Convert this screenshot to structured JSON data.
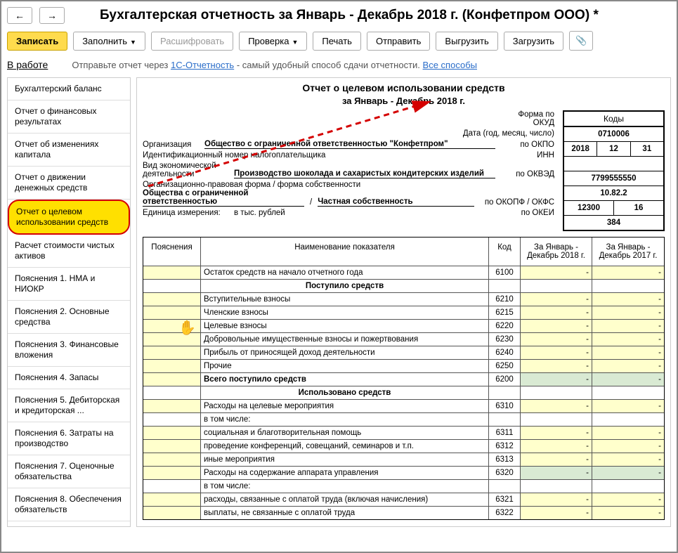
{
  "title": "Бухгалтерская отчетность за Январь - Декабрь 2018 г. (Конфетпром ООО) *",
  "nav": {
    "back": "←",
    "fwd": "→"
  },
  "toolbar": {
    "write": "Записать",
    "fill": "Заполнить",
    "decode": "Расшифровать",
    "check": "Проверка",
    "print": "Печать",
    "send": "Отправить",
    "export": "Выгрузить",
    "import": "Загрузить"
  },
  "status": {
    "label": "В работе",
    "text1": "Отправьте отчет через ",
    "link1": "1С-Отчетность",
    "text2": " - самый удобный способ сдачи отчетности. ",
    "link2": "Все способы"
  },
  "sidebar": [
    "Бухгалтерский баланс",
    "Отчет о финансовых результатах",
    "Отчет об изменениях капитала",
    "Отчет о движении денежных средств",
    "Отчет о целевом использовании средств",
    "Расчет стоимости чистых активов",
    "Пояснения 1. НМА и НИОКР",
    "Пояснения 2. Основные средства",
    "Пояснения 3. Финансовые вложения",
    "Пояснения 4. Запасы",
    "Пояснения 5. Дебиторская и кредиторская ...",
    "Пояснения 6. Затраты на производство",
    "Пояснения 7. Оценочные обязательства",
    "Пояснения 8. Обеспечения обязательств"
  ],
  "selectedIndex": 4,
  "report": {
    "title": "Отчет о целевом использовании средств",
    "period": "за Январь - Декабрь 2018 г.",
    "codes_header": "Коды",
    "rows": {
      "okud_l": "Форма по ОКУД",
      "okud_v": "0710006",
      "date_l": "Дата (год, месяц, число)",
      "date_y": "2018",
      "date_m": "12",
      "date_d": "31",
      "org_l": "Организация",
      "org_v": "Общество с ограниченной ответственностью \"Конфетпром\"",
      "okpo_l": "по ОКПО",
      "okpo_v": "",
      "inn_l": "Идентификационный номер налогоплательщика",
      "inn_r": "ИНН",
      "inn_v": "7799555550",
      "act_l": "Вид экономической деятельности",
      "act_v": "Производство шоколада и сахаристых кондитерских изделий",
      "okved_l": "по ОКВЭД",
      "okved_v": "10.82.2",
      "form_l": "Организационно-правовая форма / форма собственности",
      "form_v1": "Общества с ограниченной ответственностью",
      "form_sep": "/",
      "form_v2": "Частная собственность",
      "okopf_l": "по ОКОПФ / ОКФС",
      "okopf_v1": "12300",
      "okopf_v2": "16",
      "unit_l": "Единица измерения:",
      "unit_v": "в тыс. рублей",
      "okei_l": "по ОКЕИ",
      "okei_v": "384"
    }
  },
  "sheet": {
    "headers": {
      "p": "Пояснения",
      "n": "Наименование показателя",
      "k": "Код",
      "y1": "За Январь - Декабрь 2018 г.",
      "y2": "За Январь - Декабрь 2017 г."
    },
    "rows": [
      {
        "n": "Остаток средств на начало отчетного года",
        "k": "6100",
        "t": "data",
        "y1c": "y",
        "y2c": "y"
      },
      {
        "n": "Поступило средств",
        "t": "group"
      },
      {
        "n": "Вступительные взносы",
        "k": "6210",
        "t": "data",
        "y1c": "y",
        "y2c": "y"
      },
      {
        "n": "Членские взносы",
        "k": "6215",
        "t": "data",
        "y1c": "y",
        "y2c": "y"
      },
      {
        "n": "Целевые взносы",
        "k": "6220",
        "t": "data",
        "y1c": "y",
        "y2c": "y"
      },
      {
        "n": "Добровольные имущественные взносы и пожертвования",
        "k": "6230",
        "t": "data",
        "y1c": "y",
        "y2c": "y"
      },
      {
        "n": "Прибыль от приносящей доход деятельности",
        "k": "6240",
        "t": "data",
        "y1c": "y",
        "y2c": "y"
      },
      {
        "n": "Прочие",
        "k": "6250",
        "t": "data",
        "y1c": "y",
        "y2c": "y"
      },
      {
        "n": "Всего поступило средств",
        "k": "6200",
        "t": "total",
        "y1c": "g",
        "y2c": "g"
      },
      {
        "n": "Использовано средств",
        "t": "group"
      },
      {
        "n": "Расходы на целевые мероприятия",
        "k": "6310",
        "t": "data",
        "y1c": "y",
        "y2c": "y"
      },
      {
        "n": "в том числе:",
        "t": "label",
        "sub": 1
      },
      {
        "n": "социальная и благотворительная помощь",
        "k": "6311",
        "t": "data",
        "sub": 2,
        "y1c": "y",
        "y2c": "y"
      },
      {
        "n": "проведение конференций, совещаний, семинаров и т.п.",
        "k": "6312",
        "t": "data",
        "sub": 2,
        "y1c": "y",
        "y2c": "y"
      },
      {
        "n": "иные мероприятия",
        "k": "6313",
        "t": "data",
        "sub": 2,
        "y1c": "y",
        "y2c": "y"
      },
      {
        "n": "Расходы на содержание аппарата управления",
        "k": "6320",
        "t": "data",
        "y1c": "g",
        "y2c": "g"
      },
      {
        "n": "в том числе:",
        "t": "label",
        "sub": 1
      },
      {
        "n": "расходы, связанные с оплатой труда (включая начисления)",
        "k": "6321",
        "t": "data",
        "sub": 2,
        "y1c": "y",
        "y2c": "y"
      },
      {
        "n": "выплаты, не связанные с оплатой труда",
        "k": "6322",
        "t": "data",
        "sub": 2,
        "y1c": "y",
        "y2c": "y"
      }
    ]
  }
}
